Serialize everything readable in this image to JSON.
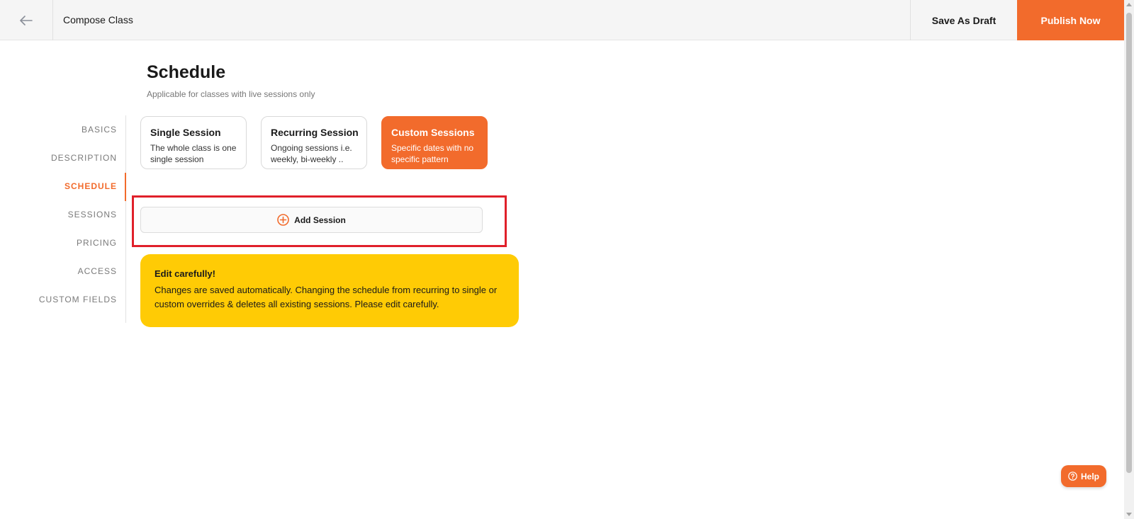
{
  "topbar": {
    "back_icon": "arrow-left-icon",
    "title": "Compose Class",
    "save_draft_label": "Save As Draft",
    "publish_label": "Publish Now"
  },
  "heading": {
    "title": "Schedule",
    "subtitle": "Applicable for classes with live sessions only"
  },
  "sidenav": {
    "items": [
      {
        "label": "BASICS",
        "active": false
      },
      {
        "label": "DESCRIPTION",
        "active": false
      },
      {
        "label": "SCHEDULE",
        "active": true
      },
      {
        "label": "SESSIONS",
        "active": false
      },
      {
        "label": "PRICING",
        "active": false
      },
      {
        "label": "ACCESS",
        "active": false
      },
      {
        "label": "CUSTOM FIELDS",
        "active": false
      }
    ]
  },
  "session_types": [
    {
      "title": "Single Session",
      "desc": "The whole class is one single session",
      "selected": false
    },
    {
      "title": "Recurring Session",
      "desc": "Ongoing sessions i.e. weekly, bi-weekly ..",
      "selected": false
    },
    {
      "title": "Custom Sessions",
      "desc": "Specific dates with no specific pattern",
      "selected": true
    }
  ],
  "add_session": {
    "icon": "plus-circle-icon",
    "label": "Add Session"
  },
  "warning": {
    "title": "Edit carefully!",
    "text": "Changes are saved automatically. Changing the schedule from recurring to single or custom overrides & deletes all existing sessions. Please edit carefully."
  },
  "help": {
    "icon": "question-circle-icon",
    "label": "Help"
  },
  "colors": {
    "accent": "#f26b2c",
    "warning": "#ffcb05",
    "highlight": "#e0202a"
  }
}
